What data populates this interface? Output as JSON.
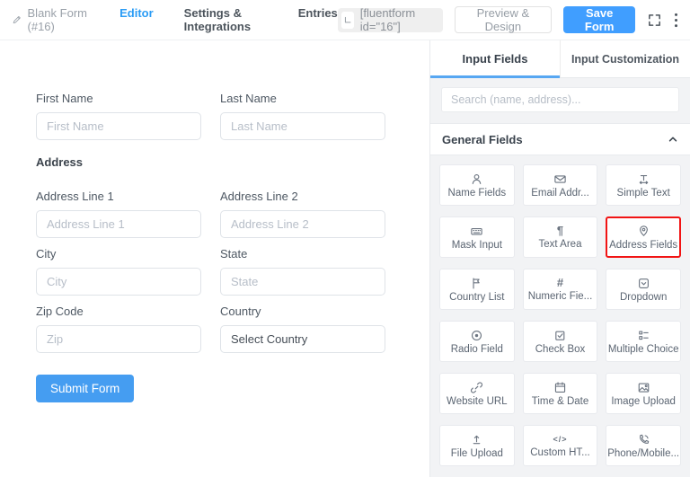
{
  "topbar": {
    "form_title": "Blank Form (#16)",
    "tabs": [
      {
        "label": "Editor",
        "active": true
      },
      {
        "label": "Settings & Integrations",
        "active": false
      },
      {
        "label": "Entries",
        "active": false
      }
    ],
    "shortcode": "[fluentform id=\"16\"]",
    "preview_button": "Preview & Design",
    "save_button": "Save Form"
  },
  "editor": {
    "name_fields": [
      {
        "label": "First Name",
        "placeholder": "First Name"
      },
      {
        "label": "Last Name",
        "placeholder": "Last Name"
      }
    ],
    "address_heading": "Address",
    "address_fields": [
      {
        "label": "Address Line 1",
        "placeholder": "Address Line 1"
      },
      {
        "label": "Address Line 2",
        "placeholder": "Address Line 2"
      },
      {
        "label": "City",
        "placeholder": "City"
      },
      {
        "label": "State",
        "placeholder": "State"
      },
      {
        "label": "Zip Code",
        "placeholder": "Zip"
      },
      {
        "label": "Country",
        "value": "Select Country"
      }
    ],
    "submit_button": "Submit Form"
  },
  "sidebar": {
    "tabs": [
      {
        "label": "Input Fields",
        "active": true
      },
      {
        "label": "Input Customization",
        "active": false
      }
    ],
    "search_placeholder": "Search (name, address)...",
    "section_title": "General Fields",
    "fields": [
      {
        "label": "Name Fields",
        "icon": "user-icon"
      },
      {
        "label": "Email Addr...",
        "icon": "email-icon"
      },
      {
        "label": "Simple Text",
        "icon": "text-width-icon"
      },
      {
        "label": "Mask Input",
        "icon": "keyboard-icon"
      },
      {
        "label": "Text Area",
        "icon": "pilcrow-icon"
      },
      {
        "label": "Address Fields",
        "icon": "map-pin-icon",
        "highlighted": true
      },
      {
        "label": "Country List",
        "icon": "flag-icon"
      },
      {
        "label": "Numeric Fie...",
        "icon": "hash-icon"
      },
      {
        "label": "Dropdown",
        "icon": "dropdown-icon"
      },
      {
        "label": "Radio Field",
        "icon": "radio-icon"
      },
      {
        "label": "Check Box",
        "icon": "checkbox-icon"
      },
      {
        "label": "Multiple Choice",
        "icon": "checklist-icon"
      },
      {
        "label": "Website URL",
        "icon": "link-icon"
      },
      {
        "label": "Time & Date",
        "icon": "calendar-icon"
      },
      {
        "label": "Image Upload",
        "icon": "image-icon"
      },
      {
        "label": "File Upload",
        "icon": "upload-icon"
      },
      {
        "label": "Custom HT...",
        "icon": "code-icon"
      },
      {
        "label": "Phone/Mobile...",
        "icon": "phone-icon"
      }
    ]
  },
  "colors": {
    "accent_blue": "#409eff",
    "active_tab_blue": "#2b9cf5",
    "tab_underline_blue": "#57a7f2",
    "highlight_red": "#f11414",
    "sidebar_bg": "#f2f3f5"
  }
}
